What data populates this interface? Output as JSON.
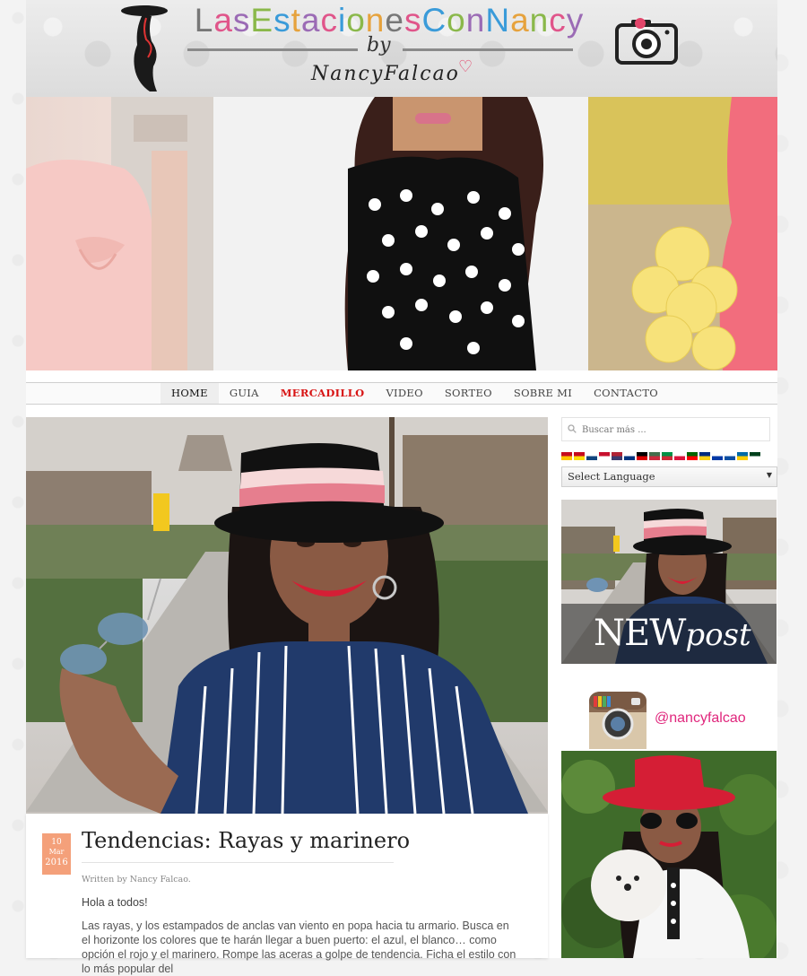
{
  "header": {
    "logo_title_letters": [
      {
        "ch": "L",
        "color": "#777777"
      },
      {
        "ch": "a",
        "color": "#e0558a"
      },
      {
        "ch": "s",
        "color": "#9b6bb5"
      },
      {
        "ch": "E",
        "color": "#8ab84a"
      },
      {
        "ch": "s",
        "color": "#3a9bd9"
      },
      {
        "ch": "t",
        "color": "#e6a23c"
      },
      {
        "ch": "a",
        "color": "#9b6bb5"
      },
      {
        "ch": "c",
        "color": "#e0558a"
      },
      {
        "ch": "i",
        "color": "#3a9bd9"
      },
      {
        "ch": "o",
        "color": "#8ab84a"
      },
      {
        "ch": "n",
        "color": "#e6a23c"
      },
      {
        "ch": "e",
        "color": "#777777"
      },
      {
        "ch": "s",
        "color": "#e0558a"
      },
      {
        "ch": "C",
        "color": "#3a9bd9"
      },
      {
        "ch": "o",
        "color": "#8ab84a"
      },
      {
        "ch": "n",
        "color": "#9b6bb5"
      },
      {
        "ch": "N",
        "color": "#3a9bd9"
      },
      {
        "ch": "a",
        "color": "#e6a23c"
      },
      {
        "ch": "n",
        "color": "#8ab84a"
      },
      {
        "ch": "c",
        "color": "#e0558a"
      },
      {
        "ch": "y",
        "color": "#9b6bb5"
      }
    ],
    "logo_by": "by",
    "logo_author": "NancyFalcao"
  },
  "nav": {
    "items": [
      {
        "label": "HOME",
        "state": "active"
      },
      {
        "label": "GUIA",
        "state": "normal"
      },
      {
        "label": "MERCADILLO",
        "state": "highlight"
      },
      {
        "label": "VIDEO",
        "state": "normal"
      },
      {
        "label": "SORTEO",
        "state": "normal"
      },
      {
        "label": "SOBRE MI",
        "state": "normal"
      },
      {
        "label": "CONTACTO",
        "state": "normal"
      }
    ]
  },
  "post": {
    "date_day": "10",
    "date_month": "Mar",
    "date_year": "2016",
    "title": "Tendencias: Rayas y marinero",
    "byline": "Written by Nancy Falcao.",
    "greeting": "Hola a todos!",
    "body": "Las rayas, y los estampados de anclas van viento en popa hacia tu armario. Busca en el horizonte los colores que te harán llegar a buen puerto: el azul, el blanco… como opción  el rojo y el  marinero. Rompe las aceras a golpe de tendencia. Ficha el estilo con lo más popular del"
  },
  "sidebar": {
    "search_placeholder": "Buscar más ...",
    "language_select": "Select Language",
    "newpost_a": "NEW",
    "newpost_b": "post",
    "instagram_handle": "@nancyfalcao",
    "flags": [
      [
        "#c60b1e",
        "#ffc400"
      ],
      [
        "#c60b1e",
        "#fcdd09"
      ],
      [
        "#ffffff",
        "#11457e"
      ],
      [
        "#c8102e",
        "#ffffff"
      ],
      [
        "#b22234",
        "#3c3b6e"
      ],
      [
        "#ffffff",
        "#003580"
      ],
      [
        "#000000",
        "#dd0000"
      ],
      [
        "#436f4d",
        "#cd2a3e"
      ],
      [
        "#009246",
        "#ce2b37"
      ],
      [
        "#ffffff",
        "#dc143c"
      ],
      [
        "#006600",
        "#ff0000"
      ],
      [
        "#002b7f",
        "#fcd116"
      ],
      [
        "#ffffff",
        "#0039a6"
      ],
      [
        "#ffffff",
        "#0b4ea2"
      ],
      [
        "#006aa7",
        "#fecc00"
      ],
      [
        "#01411c",
        "#ffffff"
      ]
    ]
  }
}
